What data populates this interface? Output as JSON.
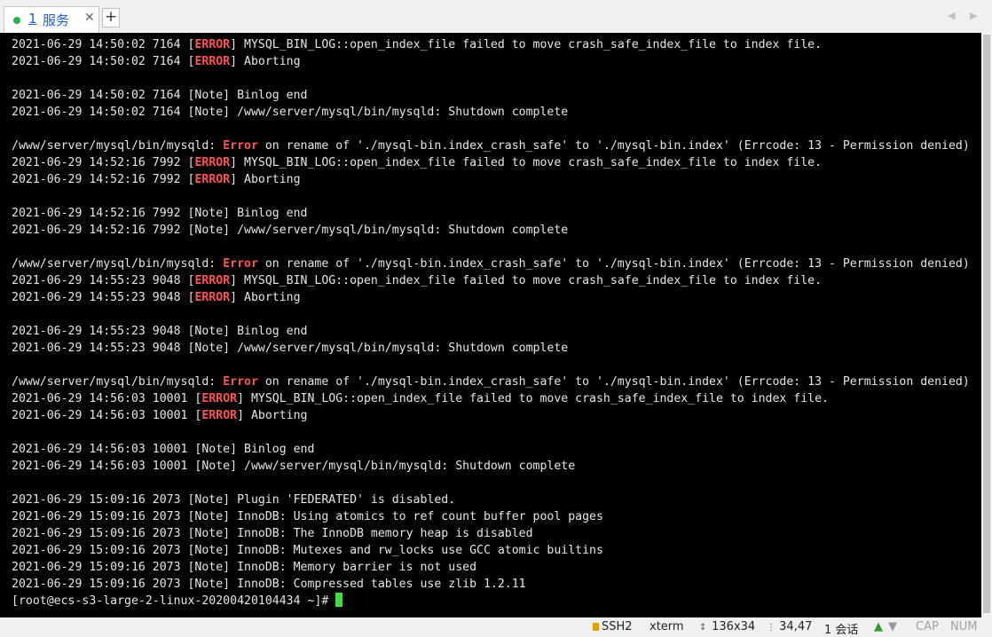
{
  "tab": {
    "number": "1",
    "title": "服务",
    "close": "✕",
    "add": "+"
  },
  "terminal_lines": [
    [
      {
        "t": "2021-06-29 14:50:02 7164 ["
      },
      {
        "t": "ERROR",
        "e": 1
      },
      {
        "t": "] MYSQL_BIN_LOG::open_index_file failed to move crash_safe_index_file to index file."
      }
    ],
    [
      {
        "t": "2021-06-29 14:50:02 7164 ["
      },
      {
        "t": "ERROR",
        "e": 1
      },
      {
        "t": "] Aborting"
      }
    ],
    [],
    [
      {
        "t": "2021-06-29 14:50:02 7164 [Note] Binlog end"
      }
    ],
    [
      {
        "t": "2021-06-29 14:50:02 7164 [Note] /www/server/mysql/bin/mysqld: Shutdown complete"
      }
    ],
    [],
    [
      {
        "t": "/www/server/mysql/bin/mysqld: "
      },
      {
        "t": "Error",
        "e": 1
      },
      {
        "t": " on rename of './mysql-bin.index_crash_safe' to './mysql-bin.index' (Errcode: 13 - Permission denied)"
      }
    ],
    [
      {
        "t": "2021-06-29 14:52:16 7992 ["
      },
      {
        "t": "ERROR",
        "e": 1
      },
      {
        "t": "] MYSQL_BIN_LOG::open_index_file failed to move crash_safe_index_file to index file."
      }
    ],
    [
      {
        "t": "2021-06-29 14:52:16 7992 ["
      },
      {
        "t": "ERROR",
        "e": 1
      },
      {
        "t": "] Aborting"
      }
    ],
    [],
    [
      {
        "t": "2021-06-29 14:52:16 7992 [Note] Binlog end"
      }
    ],
    [
      {
        "t": "2021-06-29 14:52:16 7992 [Note] /www/server/mysql/bin/mysqld: Shutdown complete"
      }
    ],
    [],
    [
      {
        "t": "/www/server/mysql/bin/mysqld: "
      },
      {
        "t": "Error",
        "e": 1
      },
      {
        "t": " on rename of './mysql-bin.index_crash_safe' to './mysql-bin.index' (Errcode: 13 - Permission denied)"
      }
    ],
    [
      {
        "t": "2021-06-29 14:55:23 9048 ["
      },
      {
        "t": "ERROR",
        "e": 1
      },
      {
        "t": "] MYSQL_BIN_LOG::open_index_file failed to move crash_safe_index_file to index file."
      }
    ],
    [
      {
        "t": "2021-06-29 14:55:23 9048 ["
      },
      {
        "t": "ERROR",
        "e": 1
      },
      {
        "t": "] Aborting"
      }
    ],
    [],
    [
      {
        "t": "2021-06-29 14:55:23 9048 [Note] Binlog end"
      }
    ],
    [
      {
        "t": "2021-06-29 14:55:23 9048 [Note] /www/server/mysql/bin/mysqld: Shutdown complete"
      }
    ],
    [],
    [
      {
        "t": "/www/server/mysql/bin/mysqld: "
      },
      {
        "t": "Error",
        "e": 1
      },
      {
        "t": " on rename of './mysql-bin.index_crash_safe' to './mysql-bin.index' (Errcode: 13 - Permission denied)"
      }
    ],
    [
      {
        "t": "2021-06-29 14:56:03 10001 ["
      },
      {
        "t": "ERROR",
        "e": 1
      },
      {
        "t": "] MYSQL_BIN_LOG::open_index_file failed to move crash_safe_index_file to index file."
      }
    ],
    [
      {
        "t": "2021-06-29 14:56:03 10001 ["
      },
      {
        "t": "ERROR",
        "e": 1
      },
      {
        "t": "] Aborting"
      }
    ],
    [],
    [
      {
        "t": "2021-06-29 14:56:03 10001 [Note] Binlog end"
      }
    ],
    [
      {
        "t": "2021-06-29 14:56:03 10001 [Note] /www/server/mysql/bin/mysqld: Shutdown complete"
      }
    ],
    [],
    [
      {
        "t": "2021-06-29 15:09:16 2073 [Note] Plugin 'FEDERATED' is disabled."
      }
    ],
    [
      {
        "t": "2021-06-29 15:09:16 2073 [Note] InnoDB: Using atomics to ref count buffer pool pages"
      }
    ],
    [
      {
        "t": "2021-06-29 15:09:16 2073 [Note] InnoDB: The InnoDB memory heap is disabled"
      }
    ],
    [
      {
        "t": "2021-06-29 15:09:16 2073 [Note] InnoDB: Mutexes and rw_locks use GCC atomic builtins"
      }
    ],
    [
      {
        "t": "2021-06-29 15:09:16 2073 [Note] InnoDB: Memory barrier is not used"
      }
    ],
    [
      {
        "t": "2021-06-29 15:09:16 2073 [Note] InnoDB: Compressed tables use zlib 1.2.11"
      }
    ]
  ],
  "prompt": "[root@ecs-s3-large-2-linux-20200420104434 ~]# ",
  "status": {
    "protocol": "SSH2",
    "term": "xterm",
    "size": "136x34",
    "position": "34,47",
    "sessions": "1 会话",
    "cap": "CAP",
    "num": "NUM"
  },
  "colors": {
    "error": "#ff5252",
    "cursor": "#3be03b",
    "tab_text": "#1b5fd6"
  }
}
